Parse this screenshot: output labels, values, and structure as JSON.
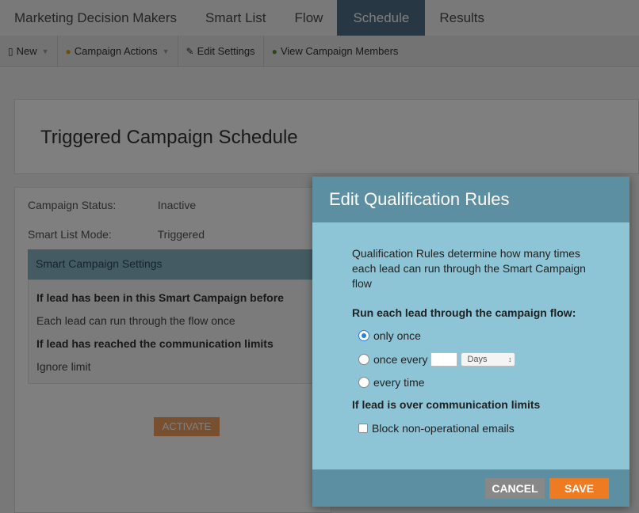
{
  "tabs": [
    {
      "label": "Marketing Decision Makers"
    },
    {
      "label": "Smart List"
    },
    {
      "label": "Flow"
    },
    {
      "label": "Schedule",
      "active": true
    },
    {
      "label": "Results"
    }
  ],
  "toolbar": {
    "new_label": "New",
    "campaign_actions_label": "Campaign Actions",
    "edit_settings_label": "Edit Settings",
    "view_members_label": "View Campaign Members"
  },
  "page": {
    "title": "Triggered Campaign Schedule",
    "status_label": "Campaign Status:",
    "status_value": "Inactive",
    "mode_label": "Smart List Mode:",
    "mode_value": "Triggered",
    "settings_head": "Smart Campaign Settings",
    "rule1_head": "If lead has been in this Smart Campaign before",
    "rule1_value": "Each lead can run through the flow once",
    "rule2_head": "If lead has reached the communication limits",
    "rule2_value": "Ignore limit",
    "activate_label": "ACTIVATE"
  },
  "modal": {
    "title": "Edit Qualification Rules",
    "description": "Qualification Rules determine how many times each lead can run through the Smart Campaign flow",
    "run_head": "Run each lead through the campaign flow:",
    "opt_once": "only once",
    "opt_every": "once every",
    "every_value": "",
    "unit_selected": "Days",
    "opt_every_time": "every time",
    "limits_head": "If lead is over communication limits",
    "block_label": "Block non-operational emails",
    "cancel_label": "CANCEL",
    "save_label": "SAVE"
  },
  "colors": {
    "accent": "#5d8fa3",
    "modal_body": "#8dc5d6",
    "save": "#ee7a22"
  }
}
